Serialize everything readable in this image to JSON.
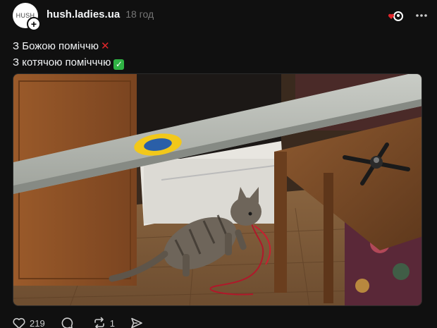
{
  "post": {
    "avatar_text": "HUSH",
    "follow_symbol": "+",
    "username": "hush.ladies.ua",
    "timestamp": "18 год",
    "caption_line1": "З Божою поміччю",
    "caption_line1_emoji": "cross-mark-emoji",
    "caption_line2": "З котячою помічччю",
    "caption_line2_emoji": "check-mark-emoji",
    "media_description_icon": "photo-kitten-drone"
  },
  "actions": {
    "likes": "219",
    "replies": "",
    "reposts": "1",
    "share": ""
  },
  "colors": {
    "background": "#101010",
    "text": "#f3f5f7",
    "muted": "#777777",
    "heart_red": "#e0262b",
    "check_green": "#2fb344",
    "flag_blue": "#2a5fa8",
    "flag_yellow": "#f2c81a"
  }
}
